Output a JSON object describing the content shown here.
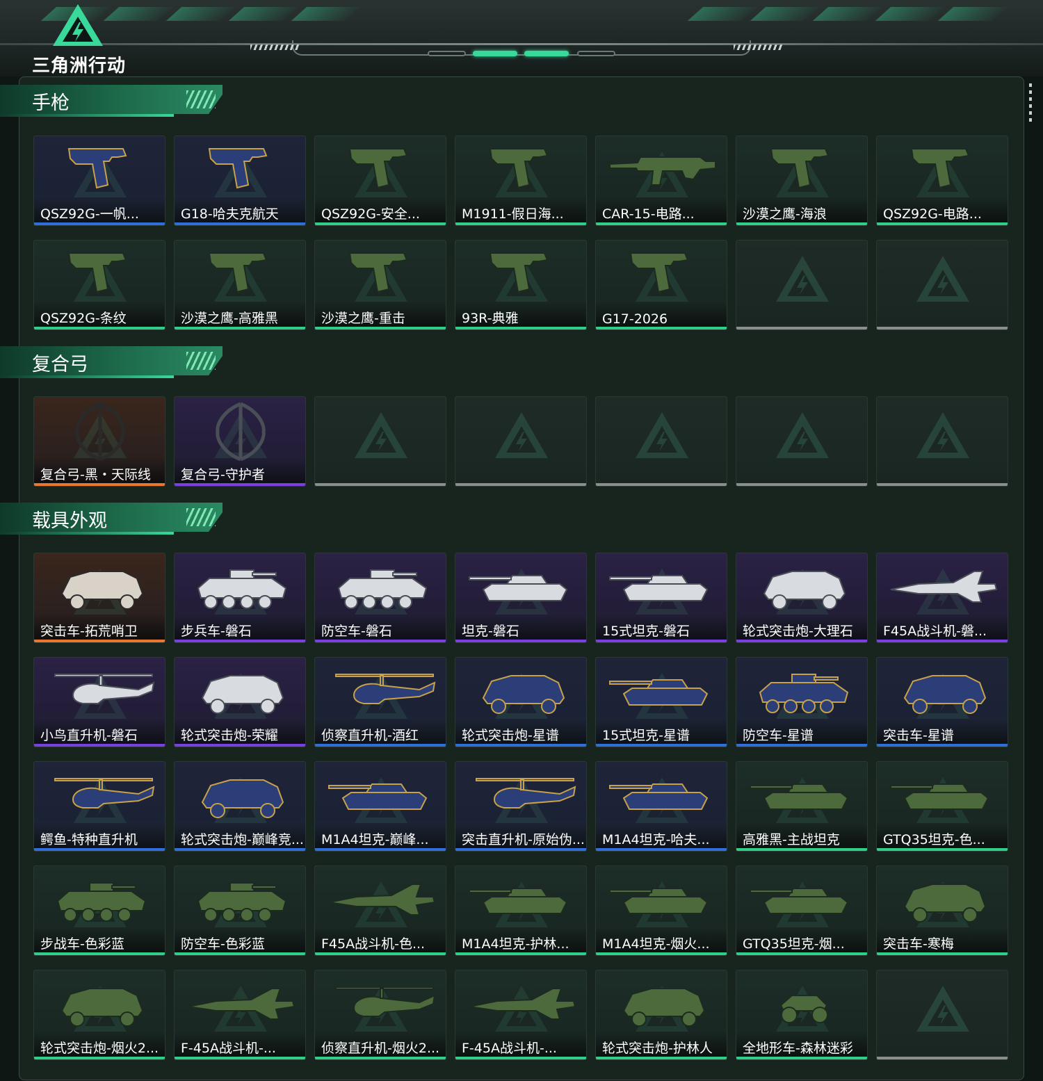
{
  "logo": {
    "text": "三角洲行动"
  },
  "colors": {
    "accent": "#38d99a",
    "legend": "#e8782e",
    "epic": "#7a3fe0",
    "rare": "#2f6fd8",
    "common": "#2fcf8a",
    "empty": "#8a8f8e"
  },
  "sections": [
    {
      "title": "手枪",
      "items": [
        {
          "name": "QSZ92G-一帆...",
          "rarity": "rare",
          "icon": "pistol-icon"
        },
        {
          "name": "G18-哈夫克航天",
          "rarity": "rare",
          "icon": "pistol-icon"
        },
        {
          "name": "QSZ92G-安全...",
          "rarity": "common",
          "icon": "pistol-icon"
        },
        {
          "name": "M1911-假日海...",
          "rarity": "common",
          "icon": "pistol-icon"
        },
        {
          "name": "CAR-15-电路...",
          "rarity": "common",
          "icon": "rifle-icon"
        },
        {
          "name": "沙漠之鹰-海浪",
          "rarity": "common",
          "icon": "pistol-icon"
        },
        {
          "name": "QSZ92G-电路...",
          "rarity": "common",
          "icon": "pistol-icon"
        },
        {
          "name": "QSZ92G-条纹",
          "rarity": "common",
          "icon": "pistol-icon"
        },
        {
          "name": "沙漠之鹰-高雅黑",
          "rarity": "common",
          "icon": "pistol-icon"
        },
        {
          "name": "沙漠之鹰-重击",
          "rarity": "common",
          "icon": "pistol-icon"
        },
        {
          "name": "93R-典雅",
          "rarity": "common",
          "icon": "pistol-icon"
        },
        {
          "name": "G17-2026",
          "rarity": "common",
          "icon": "pistol-icon"
        },
        {
          "name": "",
          "rarity": "empty",
          "icon": ""
        },
        {
          "name": "",
          "rarity": "empty",
          "icon": ""
        }
      ]
    },
    {
      "title": "复合弓",
      "items": [
        {
          "name": "复合弓-黑・天际线",
          "rarity": "legend",
          "icon": "bow-icon"
        },
        {
          "name": "复合弓-守护者",
          "rarity": "epic",
          "icon": "bow-icon"
        },
        {
          "name": "",
          "rarity": "empty",
          "icon": ""
        },
        {
          "name": "",
          "rarity": "empty",
          "icon": ""
        },
        {
          "name": "",
          "rarity": "empty",
          "icon": ""
        },
        {
          "name": "",
          "rarity": "empty",
          "icon": ""
        },
        {
          "name": "",
          "rarity": "empty",
          "icon": ""
        }
      ]
    },
    {
      "title": "载具外观",
      "items": [
        {
          "name": "突击车-拓荒哨卫",
          "rarity": "legend",
          "icon": "truck-icon"
        },
        {
          "name": "步兵车-磐石",
          "rarity": "epic",
          "icon": "apc-icon"
        },
        {
          "name": "防空车-磐石",
          "rarity": "epic",
          "icon": "apc-icon"
        },
        {
          "name": "坦克-磐石",
          "rarity": "epic",
          "icon": "tank-icon"
        },
        {
          "name": "15式坦克-磐石",
          "rarity": "epic",
          "icon": "tank-icon"
        },
        {
          "name": "轮式突击炮-大理石",
          "rarity": "epic",
          "icon": "truck-icon"
        },
        {
          "name": "F45A战斗机-磐...",
          "rarity": "epic",
          "icon": "jet-icon"
        },
        {
          "name": "小鸟直升机-磐石",
          "rarity": "epic",
          "icon": "helicopter-icon"
        },
        {
          "name": "轮式突击炮-荣耀",
          "rarity": "epic",
          "icon": "truck-icon"
        },
        {
          "name": "侦察直升机-酒红",
          "rarity": "rare",
          "icon": "helicopter-icon"
        },
        {
          "name": "轮式突击炮-星谱",
          "rarity": "rare",
          "icon": "truck-icon"
        },
        {
          "name": "15式坦克-星谱",
          "rarity": "rare",
          "icon": "tank-icon"
        },
        {
          "name": "防空车-星谱",
          "rarity": "rare",
          "icon": "apc-icon"
        },
        {
          "name": "突击车-星谱",
          "rarity": "rare",
          "icon": "truck-icon"
        },
        {
          "name": "鳄鱼-特种直升机",
          "rarity": "rare",
          "icon": "helicopter-icon"
        },
        {
          "name": "轮式突击炮-巅峰竞...",
          "rarity": "rare",
          "icon": "truck-icon"
        },
        {
          "name": "M1A4坦克-巅峰...",
          "rarity": "rare",
          "icon": "tank-icon"
        },
        {
          "name": "突击直升机-原始伪...",
          "rarity": "rare",
          "icon": "helicopter-icon"
        },
        {
          "name": "M1A4坦克-哈夫...",
          "rarity": "rare",
          "icon": "tank-icon"
        },
        {
          "name": "高雅黑-主战坦克",
          "rarity": "common",
          "icon": "tank-icon"
        },
        {
          "name": "GTQ35坦克-色...",
          "rarity": "common",
          "icon": "tank-icon"
        },
        {
          "name": "步战车-色彩蓝",
          "rarity": "common",
          "icon": "apc-icon"
        },
        {
          "name": "防空车-色彩蓝",
          "rarity": "common",
          "icon": "apc-icon"
        },
        {
          "name": "F45A战斗机-色...",
          "rarity": "common",
          "icon": "jet-icon"
        },
        {
          "name": "M1A4坦克-护林...",
          "rarity": "common",
          "icon": "tank-icon"
        },
        {
          "name": "M1A4坦克-烟火...",
          "rarity": "common",
          "icon": "tank-icon"
        },
        {
          "name": "GTQ35坦克-烟...",
          "rarity": "common",
          "icon": "tank-icon"
        },
        {
          "name": "突击车-寒梅",
          "rarity": "common",
          "icon": "truck-icon"
        },
        {
          "name": "轮式突击炮-烟火2...",
          "rarity": "common",
          "icon": "truck-icon"
        },
        {
          "name": "F-45A战斗机-...",
          "rarity": "common",
          "icon": "jet-icon"
        },
        {
          "name": "侦察直升机-烟火2...",
          "rarity": "common",
          "icon": "helicopter-icon"
        },
        {
          "name": "F-45A战斗机-...",
          "rarity": "common",
          "icon": "jet-icon"
        },
        {
          "name": "轮式突击炮-护林人",
          "rarity": "common",
          "icon": "truck-icon"
        },
        {
          "name": "全地形车-森林迷彩",
          "rarity": "common",
          "icon": "atv-icon"
        },
        {
          "name": "",
          "rarity": "empty",
          "icon": ""
        }
      ]
    }
  ]
}
